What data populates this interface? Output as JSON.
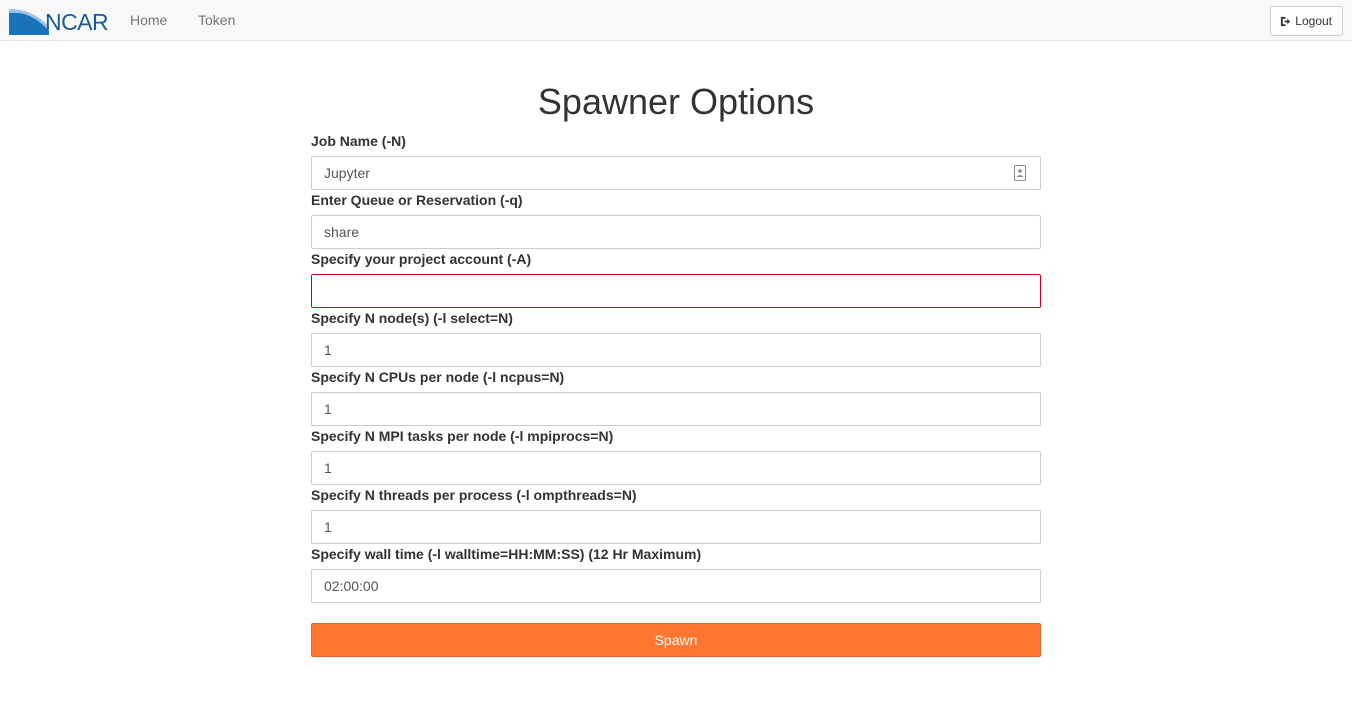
{
  "navbar": {
    "brand_text": "NCAR",
    "links": [
      {
        "label": "Home"
      },
      {
        "label": "Token"
      }
    ],
    "logout_label": "Logout"
  },
  "page": {
    "title": "Spawner Options",
    "spawn_label": "Spawn"
  },
  "form": {
    "fields": [
      {
        "label": "Job Name (-N)",
        "value": "Jupyter"
      },
      {
        "label": "Enter Queue or Reservation (-q)",
        "value": "share"
      },
      {
        "label": "Specify your project account (-A)",
        "value": ""
      },
      {
        "label": "Specify N node(s) (-l select=N)",
        "value": "1"
      },
      {
        "label": "Specify N CPUs per node (-l ncpus=N)",
        "value": "1"
      },
      {
        "label": "Specify N MPI tasks per node (-l mpiprocs=N)",
        "value": "1"
      },
      {
        "label": "Specify N threads per process (-l ompthreads=N)",
        "value": "1"
      },
      {
        "label": "Specify wall time (-l walltime=HH:MM:SS) (12 Hr Maximum)",
        "value": "02:00:00"
      }
    ]
  },
  "colors": {
    "brand_blue": "#1a5a96",
    "spawn_orange": "#ff7631",
    "invalid_border": "#d0021b"
  },
  "icons": {
    "logout": "logout-icon",
    "autofill": "contact-card-icon"
  }
}
